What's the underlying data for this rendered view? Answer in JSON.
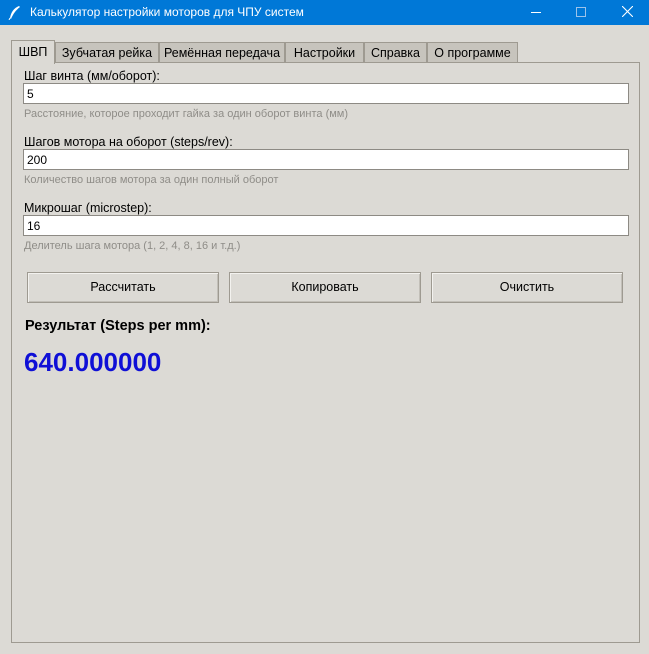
{
  "window": {
    "title": "Калькулятор настройки моторов для ЧПУ систем",
    "icon": "feather-icon",
    "controls": [
      "minimize-icon",
      "maximize-icon",
      "close-icon"
    ]
  },
  "tabs": [
    {
      "label": "ШВП",
      "active": true
    },
    {
      "label": "Зубчатая рейка",
      "active": false
    },
    {
      "label": "Ремённая передача",
      "active": false
    },
    {
      "label": "Настройки",
      "active": false
    },
    {
      "label": "Справка",
      "active": false
    },
    {
      "label": "О программе",
      "active": false
    }
  ],
  "form": {
    "fields": [
      {
        "label": "Шаг винта (мм/оборот):",
        "value": "5",
        "hint": "Расстояние, которое проходит гайка за один оборот винта (мм)"
      },
      {
        "label": "Шагов мотора на оборот (steps/rev):",
        "value": "200",
        "hint": "Количество шагов мотора за один полный оборот"
      },
      {
        "label": "Микрошаг (microstep):",
        "value": "16",
        "hint": "Делитель шага мотора (1, 2, 4, 8, 16 и т.д.)"
      }
    ]
  },
  "buttons": {
    "calculate": "Рассчитать",
    "copy": "Копировать",
    "clear": "Очистить"
  },
  "result": {
    "label": "Результат (Steps per mm):",
    "value": "640.000000",
    "color": "#0f0fd6"
  },
  "colors": {
    "titlebar": "#0078d7",
    "background": "#dcdad5",
    "hint": "#8f8d88"
  }
}
